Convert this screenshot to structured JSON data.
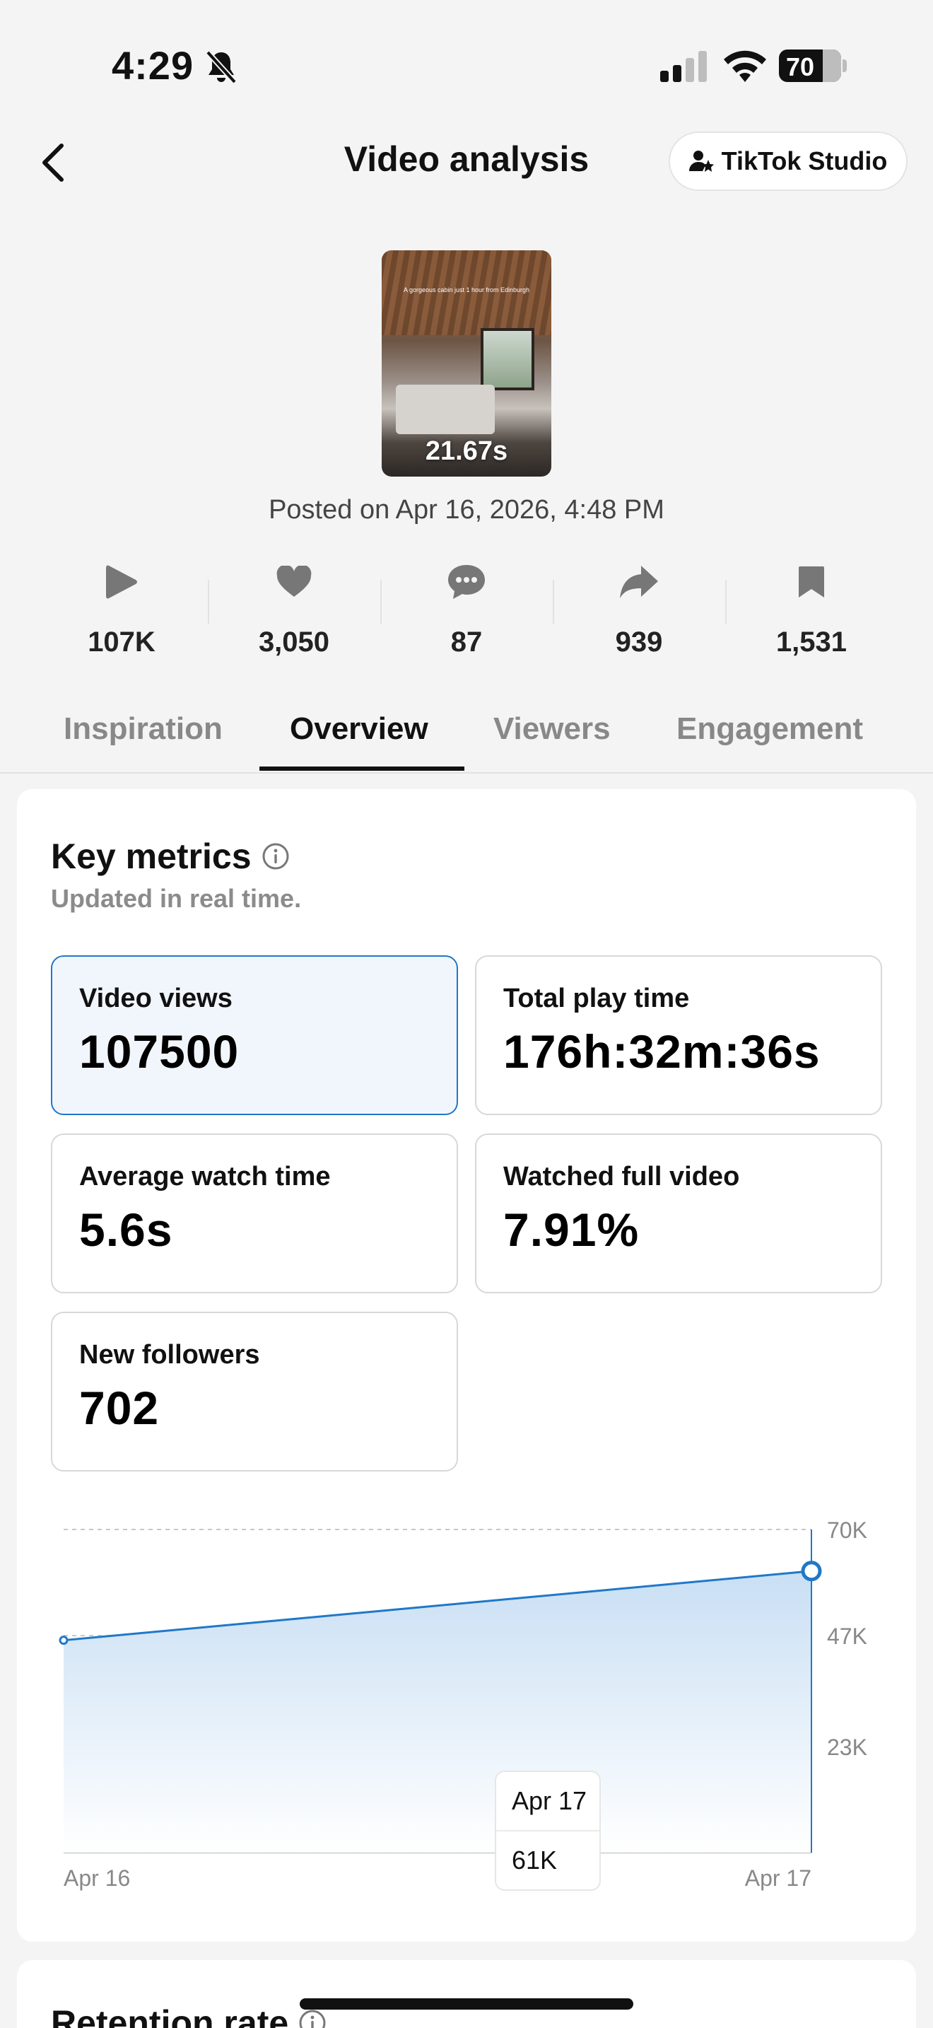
{
  "status_bar": {
    "time": "4:29",
    "battery": "70",
    "battery_level_percent": 70
  },
  "header": {
    "title": "Video analysis",
    "studio_button_label": "TikTok Studio"
  },
  "video": {
    "duration": "21.67s",
    "caption": "A gorgeous cabin just 1 hour from Edinburgh",
    "posted": "Posted on Apr 16, 2026, 4:48 PM"
  },
  "stats": [
    {
      "icon": "play-icon",
      "value": "107K"
    },
    {
      "icon": "heart-icon",
      "value": "3,050"
    },
    {
      "icon": "comment-icon",
      "value": "87"
    },
    {
      "icon": "share-icon",
      "value": "939"
    },
    {
      "icon": "bookmark-icon",
      "value": "1,531"
    }
  ],
  "tabs": [
    {
      "label": "Inspiration",
      "active": false
    },
    {
      "label": "Overview",
      "active": true
    },
    {
      "label": "Viewers",
      "active": false
    },
    {
      "label": "Engagement",
      "active": false
    }
  ],
  "key_metrics": {
    "title": "Key metrics",
    "subtitle": "Updated in real time.",
    "items": [
      {
        "label": "Video views",
        "value": "107500",
        "selected": true
      },
      {
        "label": "Total play time",
        "value": "176h:32m:36s",
        "selected": false
      },
      {
        "label": "Average watch time",
        "value": "5.6s",
        "selected": false
      },
      {
        "label": "Watched full video",
        "value": "7.91%",
        "selected": false
      },
      {
        "label": "New followers",
        "value": "702",
        "selected": false
      }
    ]
  },
  "chart_data": {
    "type": "area",
    "x": [
      "Apr 16",
      "Apr 17"
    ],
    "values": [
      46000,
      61000
    ],
    "x_tick_labels": [
      "Apr 16",
      "Apr 17"
    ],
    "y_tick_labels": [
      "70K",
      "47K",
      "23K"
    ],
    "y_ticks": [
      70000,
      47000,
      23000
    ],
    "ylim": [
      0,
      70000
    ],
    "grid": true,
    "colors": {
      "line": "#1f78c8",
      "fill_top": "#c9dff4",
      "fill_bottom": "#ffffff"
    },
    "tooltip": {
      "date": "Apr 17",
      "value": "61K"
    }
  },
  "next_section": {
    "title": "Retention rate"
  }
}
